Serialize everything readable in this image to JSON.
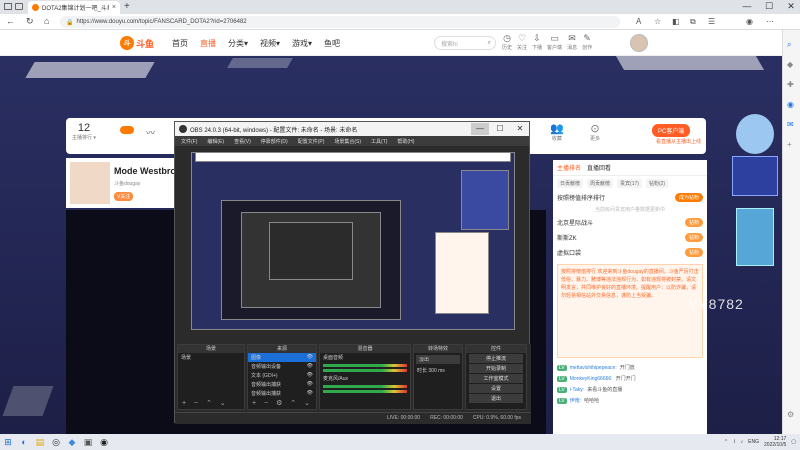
{
  "browser": {
    "tab_title": "DOTA2集锦计划一吧_斗鱼直播",
    "tab_close": "×",
    "new_tab": "+",
    "url": "https://www.douyu.com/topic/FANSCARD_DOTA2?rid=2706482",
    "window": {
      "minimize": "—",
      "maximize": "☐",
      "close": "✕"
    }
  },
  "site": {
    "logo_text": "斗鱼",
    "nav": [
      "首页",
      "直播",
      "分类▾",
      "视频▾",
      "游戏▾",
      "鱼吧"
    ],
    "search_placeholder": "搜索hi",
    "header_icons": [
      "历史",
      "关注",
      "下播",
      "客户端",
      "消息",
      "创作"
    ]
  },
  "stats": {
    "rank_value": "12",
    "rank_label": "主播排行 ▾",
    "items": [
      "",
      "",
      "",
      "",
      "",
      "",
      "",
      "",
      "",
      "",
      "",
      "收藏",
      "更多"
    ],
    "pc_button": "PC客户端",
    "pc_sub": "看直播从主播出上线"
  },
  "streamer": {
    "name": "Mode Westbro",
    "tag": "斗鱼dougay",
    "follow": "V关注"
  },
  "obs": {
    "title": "OBS 24.0.3 (64-bit, windows) - 配置文件: 未命名 - 场景: 未命名",
    "menu": [
      "文件(F)",
      "编辑(E)",
      "查看(V)",
      "停靠部件(D)",
      "配置文件(P)",
      "场景集合(S)",
      "工具(T)",
      "帮助(H)"
    ],
    "docks": {
      "scenes": {
        "header": "场景",
        "rows": [
          "场景"
        ]
      },
      "sources": {
        "header": "来源",
        "rows": [
          "图像",
          "音频输出设备",
          "文本 (GDI+)",
          "音频输出捕获",
          "音频输出捕获"
        ]
      },
      "mixer": {
        "header": "混音器",
        "rows": [
          "桌面音频",
          "麦克风/Aux"
        ]
      },
      "transitions": {
        "header": "转场特效",
        "rows": [
          "淡出",
          "时长 300 ms"
        ]
      },
      "controls": {
        "header": "控件",
        "buttons": [
          "停止推流",
          "开始录制",
          "工作室模式",
          "设置",
          "退出"
        ]
      }
    },
    "status": [
      "LIVE: 00:00:00",
      "REC: 00:00:00",
      "CPU: 0.9%, 60.00 fps"
    ]
  },
  "chat": {
    "tabs": [
      "主播排名",
      "直播回看"
    ],
    "subtabs": [
      "日贡献榜",
      "周贡献榜",
      "贵宾(17)",
      "钻粉(2)"
    ],
    "title": "按照榜值排序排行",
    "title_btn": "成为钻粉",
    "hint": "当前房间贵宾用户量数据更新中",
    "ranks": [
      {
        "name": "北京星际战斗",
        "badge": "钻粉"
      },
      {
        "name": "斯斯ZK",
        "badge": "钻粉"
      },
      {
        "name": "虚拟口袋",
        "badge": "钻粉"
      }
    ],
    "announcement": "按照排榜值排行 欢迎来到斗鱼dougay的直播间，斗鱼严厉打击低俗、暴力、赌博等违法违规行为，如有违规将被封禁。请文明发言，共同维护良好的直播环境。提醒用户：以防诈骗，请勿轻易相信站外交易信息，谨防上当受骗。",
    "messages": [
      {
        "lv": "LV",
        "name": "mettavishihipepeace:",
        "text": "开门放"
      },
      {
        "lv": "LV",
        "name": "MonkeyKing66666:",
        "text": "开门开门"
      },
      {
        "lv": "LV",
        "name": "i-Taky:",
        "text": "来看斗鱼的直播"
      },
      {
        "lv": "LV",
        "name": "伊南:",
        "text": "哈哈哈"
      }
    ]
  },
  "side": {
    "yy_text": "YY8782"
  },
  "taskbar": {
    "lang": "ENG",
    "time": "12:17",
    "date": "2022/10/5"
  }
}
